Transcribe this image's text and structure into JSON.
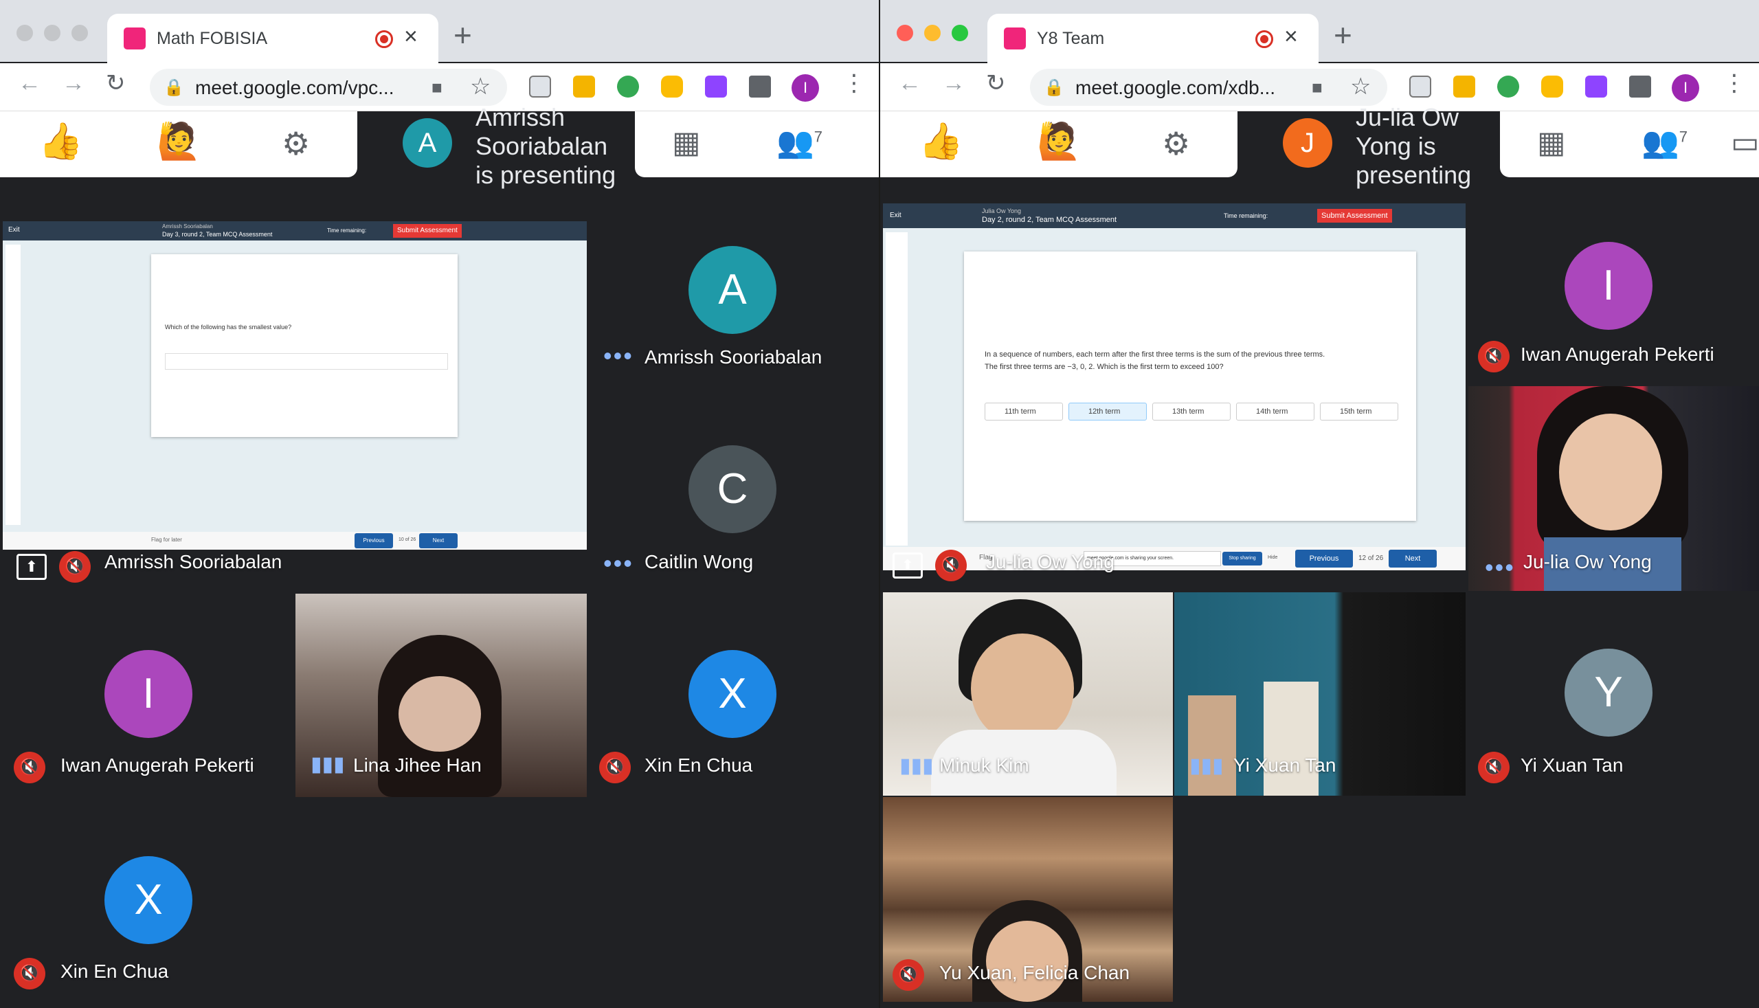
{
  "colors": {
    "meet_pink": "#f0257a",
    "mute_red": "#d93025",
    "teal": "#1f9aa8",
    "orange": "#f26b1d",
    "purple": "#ab47bc",
    "grey": "#4a5459",
    "blue": "#1e88e5"
  },
  "left": {
    "tab_title": "Math FOBISIA",
    "url": "meet.google.com/vpc...",
    "presenter_initial": "A",
    "presenter_text": [
      "Amrissh",
      "Sooriabalan",
      "is presenting"
    ],
    "participants_count": "7",
    "screen": {
      "presenter_name": "Amrissh Sooriabalan",
      "exit": "Exit",
      "heading": "Day 3, round 2, Team MCQ Assessment",
      "time_remaining": "Time remaining:",
      "submit": "Submit Assessment",
      "question": "Which of the following has the smallest value?",
      "previous": "Previous",
      "next": "Next",
      "page": "10 of 26",
      "flag": "Flag for later"
    },
    "presenting_tile_name": "Amrissh Sooriabalan",
    "tiles": [
      {
        "initial": "A",
        "name": "Amrissh Sooriabalan"
      },
      {
        "initial": "C",
        "name": "Caitlin Wong"
      },
      {
        "initial": "I",
        "name": "Iwan Anugerah Pekerti"
      },
      {
        "initial": "",
        "name": "Lina Jihee Han"
      },
      {
        "initial": "X",
        "name": "Xin En Chua"
      },
      {
        "initial": "X",
        "name": "Xin En Chua"
      }
    ]
  },
  "right": {
    "tab_title": "Y8 Team",
    "url": "meet.google.com/xdb...",
    "presenter_initial": "J",
    "presenter_text": [
      "Ju-lia Ow",
      "Yong is",
      "presenting"
    ],
    "participants_count": "7",
    "screen": {
      "presenter_name": "Julia Ow Yong",
      "exit": "Exit",
      "heading": "Day 2, round 2, Team MCQ Assessment",
      "time_remaining": "Time remaining:",
      "submit": "Submit Assessment",
      "question_line1": "In a sequence of numbers, each term after the first three terms is the sum of the previous three terms.",
      "question_line2": "The first three terms are −3, 0, 2. Which is the first term to exceed 100?",
      "options": [
        "11th term",
        "12th term",
        "13th term",
        "14th term",
        "15th term"
      ],
      "previous": "Previous",
      "next": "Next",
      "page": "12 of 26",
      "sharing_notice": "meet.google.com is sharing your screen.",
      "stop_sharing": "Stop sharing",
      "hide": "Hide",
      "flag": "Flag"
    },
    "presenting_tile_name": "Ju-lia Ow Yong",
    "tiles": [
      {
        "initial": "I",
        "name": "Iwan Anugerah Pekerti"
      },
      {
        "initial": "",
        "name": "Ju-lia Ow Yong"
      },
      {
        "initial": "",
        "name": "Minuk Kim"
      },
      {
        "initial": "",
        "name": "Yi Xuan Tan"
      },
      {
        "initial": "Y",
        "name": "Yi Xuan Tan"
      },
      {
        "initial": "",
        "name": "Yu Xuan, Felicia Chan"
      }
    ]
  }
}
